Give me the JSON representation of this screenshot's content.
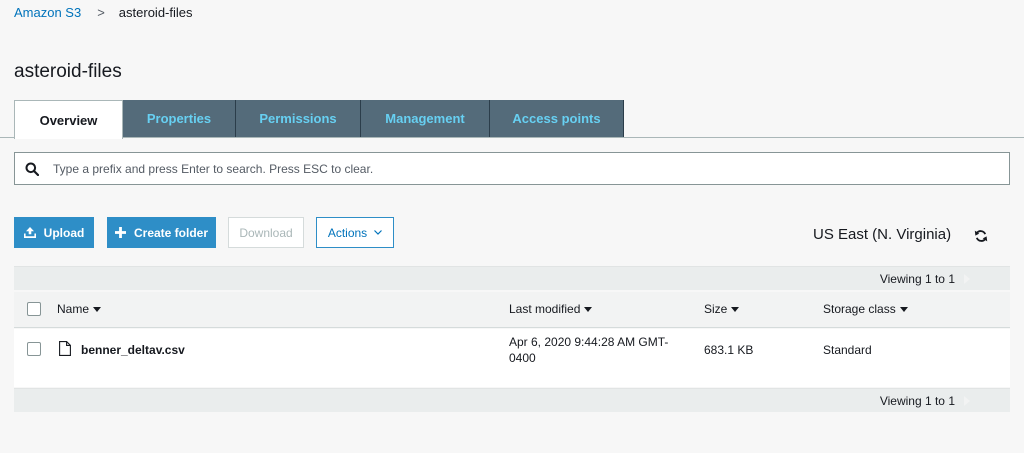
{
  "breadcrumb": {
    "root": "Amazon S3",
    "separator": ">",
    "current": "asteroid-files"
  },
  "page_title": "asteroid-files",
  "tabs": [
    {
      "label": "Overview",
      "active": true
    },
    {
      "label": "Properties",
      "active": false
    },
    {
      "label": "Permissions",
      "active": false
    },
    {
      "label": "Management",
      "active": false
    },
    {
      "label": "Access points",
      "active": false
    }
  ],
  "search": {
    "placeholder": "Type a prefix and press Enter to search. Press ESC to clear.",
    "value": ""
  },
  "toolbar": {
    "upload_label": "Upload",
    "create_folder_label": "Create folder",
    "download_label": "Download",
    "actions_label": "Actions"
  },
  "region": "US East (N. Virginia)",
  "table": {
    "viewing_top": "Viewing 1 to 1",
    "viewing_bottom": "Viewing 1 to 1",
    "columns": {
      "name": "Name",
      "last_modified": "Last modified",
      "size": "Size",
      "storage_class": "Storage class"
    },
    "rows": [
      {
        "name": "benner_deltav.csv",
        "last_modified": "Apr 6, 2020 9:44:28 AM GMT-0400",
        "size": "683.1 KB",
        "storage_class": "Standard"
      }
    ]
  },
  "colors": {
    "link": "#0073bb",
    "tab_inactive_bg": "#546b7a",
    "tab_inactive_text": "#67d0f2",
    "primary_button": "#2e8ec7"
  }
}
